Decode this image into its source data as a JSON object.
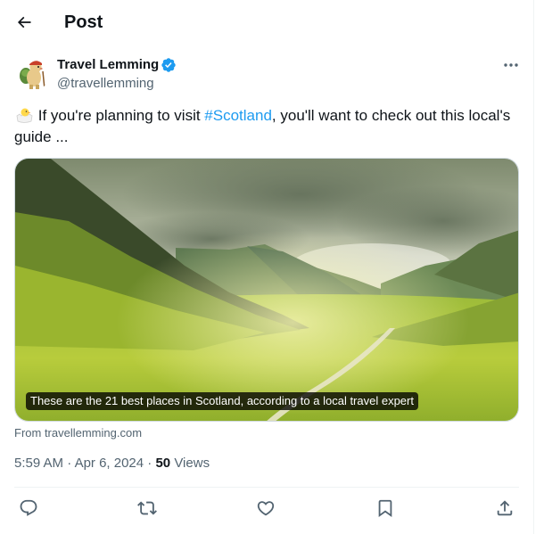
{
  "header": {
    "back_icon": "arrow-left-icon",
    "title": "Post"
  },
  "author": {
    "name": "Travel Lemming",
    "handle": "@travellemming",
    "verified": true,
    "verified_color": "#1d9bf0"
  },
  "post": {
    "text_before": " If you're planning to visit ",
    "hashtag": "#Scotland",
    "text_after": ", you'll want to check out this local's guide ...",
    "emoji": "hatching-chick"
  },
  "card": {
    "caption": "These are the 21 best places in Scotland, according to a local travel expert",
    "source": "From travellemming.com"
  },
  "meta": {
    "time": "5:59 AM",
    "separator": "·",
    "date": "Apr 6, 2024",
    "views_count": "50",
    "views_label": "Views"
  },
  "actions": {
    "reply_icon": "reply-icon",
    "repost_icon": "repost-icon",
    "like_icon": "heart-icon",
    "bookmark_icon": "bookmark-icon",
    "share_icon": "share-icon"
  },
  "colors": {
    "text": "#0f1419",
    "secondary": "#536471",
    "link": "#1d9bf0",
    "border": "#eff3f4"
  }
}
